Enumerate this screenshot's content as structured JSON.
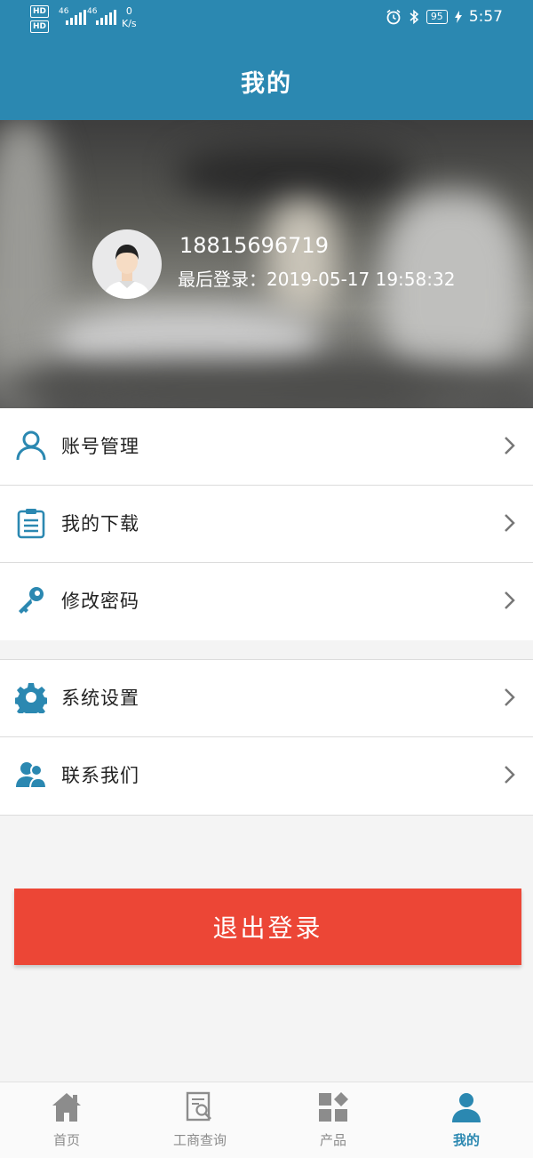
{
  "status_bar": {
    "hd_label": "HD",
    "net_type": "46",
    "net_speed_value": "0",
    "net_speed_unit": "K/s",
    "battery": "95",
    "time": "5:57"
  },
  "header": {
    "title": "我的"
  },
  "profile": {
    "phone": "18815696719",
    "last_login_label": "最后登录：",
    "last_login_value": "2019-05-17 19:58:32"
  },
  "menu_group_1": [
    {
      "icon": "user-icon",
      "label": "账号管理"
    },
    {
      "icon": "clipboard-icon",
      "label": "我的下载"
    },
    {
      "icon": "key-icon",
      "label": "修改密码"
    }
  ],
  "menu_group_2": [
    {
      "icon": "gear-icon",
      "label": "系统设置"
    },
    {
      "icon": "contacts-icon",
      "label": "联系我们"
    }
  ],
  "logout_button": {
    "label": "退出登录"
  },
  "tabbar": [
    {
      "icon": "home-icon",
      "label": "首页",
      "active": false
    },
    {
      "icon": "search-document-icon",
      "label": "工商查询",
      "active": false
    },
    {
      "icon": "grid-icon",
      "label": "产品",
      "active": false
    },
    {
      "icon": "person-icon",
      "label": "我的",
      "active": true
    }
  ],
  "colors": {
    "primary": "#2b88b1",
    "logout_red": "#ec4636",
    "tab_inactive": "#8c8c8c"
  }
}
